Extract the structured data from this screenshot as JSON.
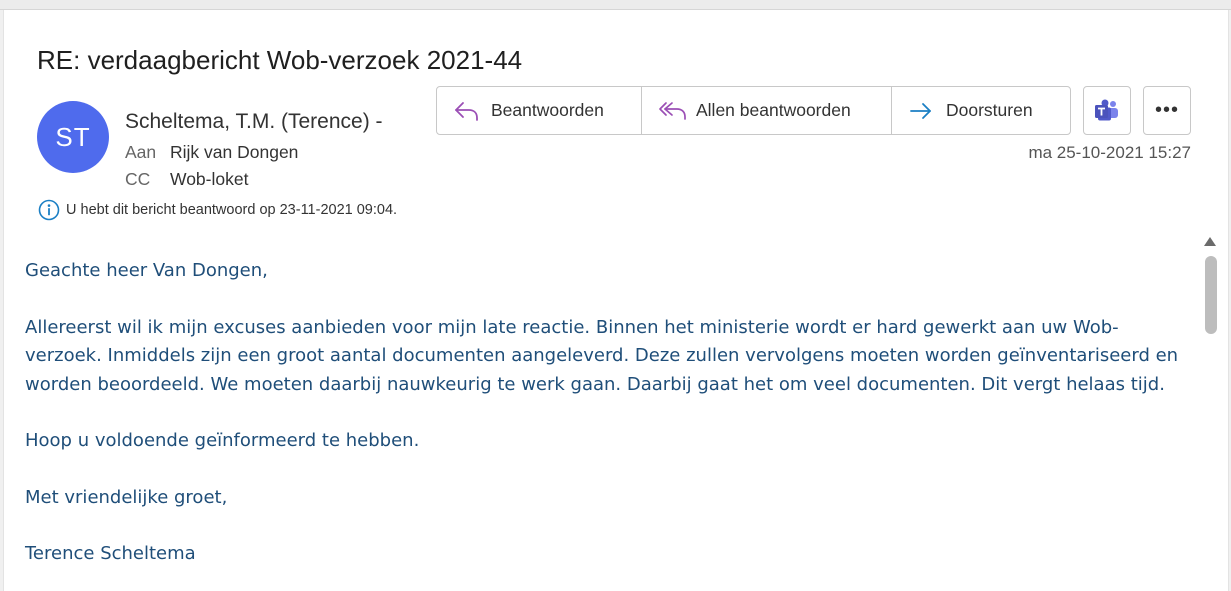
{
  "email": {
    "subject": "RE: verdaagbericht Wob-verzoek 2021-44",
    "avatar_initials": "ST",
    "avatar_color": "#4f6bed",
    "sender": "Scheltema, T.M. (Terence) -",
    "to_label": "Aan",
    "to_value": "Rijk van Dongen",
    "cc_label": "CC",
    "cc_value": "Wob-loket",
    "info_text": "U hebt dit bericht beantwoord op 23-11-2021 09:04.",
    "date": "ma 25-10-2021 15:27"
  },
  "actions": {
    "reply": "Beantwoorden",
    "reply_all": "Allen beantwoorden",
    "forward": "Doorsturen",
    "teams_icon": "teams-icon",
    "more_icon": "more-options-icon",
    "more_label": "•••"
  },
  "body": {
    "color": "#1f4e79",
    "paragraphs": [
      "Geachte heer Van Dongen,",
      "Allereerst wil ik mijn excuses aanbieden voor mijn late reactie. Binnen het ministerie wordt er hard gewerkt aan uw Wob-verzoek. Inmiddels zijn een groot aantal documenten aangeleverd. Deze zullen vervolgens moeten worden geïnventariseerd en worden beoordeeld. We moeten daarbij nauwkeurig te werk gaan. Daarbij gaat het om veel documenten. Dit vergt helaas tijd.",
      "Hoop u voldoende geïnformeerd te hebben.",
      "Met vriendelijke groet,",
      "Terence Scheltema"
    ]
  }
}
